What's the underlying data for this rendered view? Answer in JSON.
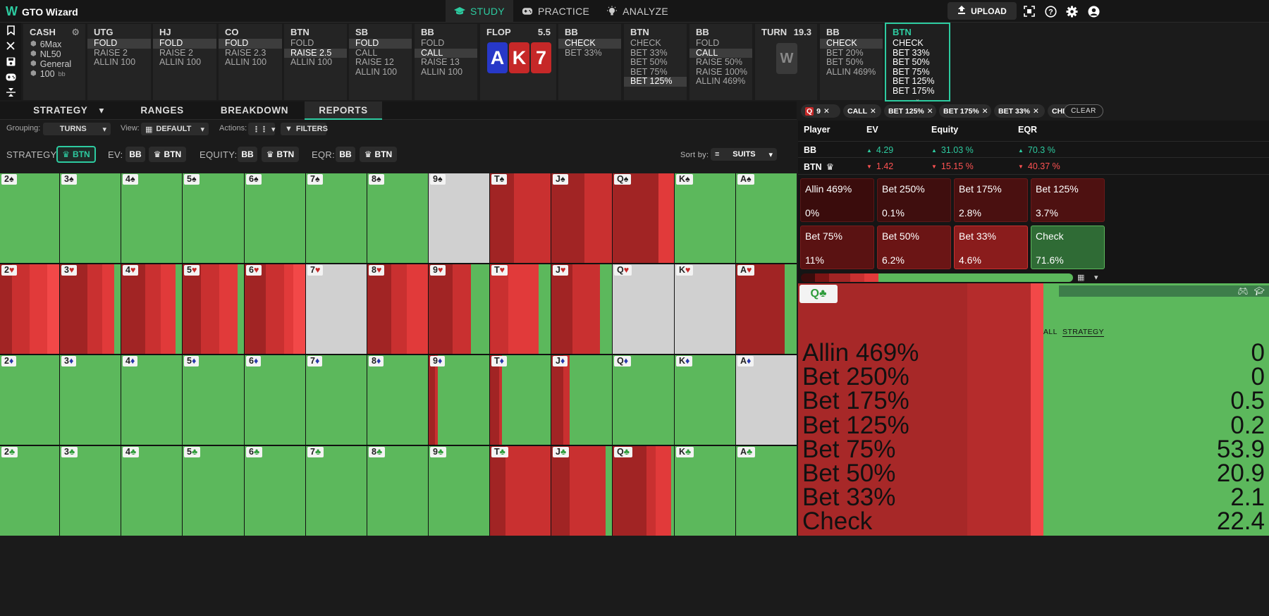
{
  "app": {
    "title": "GTO Wizard",
    "logo": "W",
    "brand_color": "#2dcba0"
  },
  "nav": {
    "tabs": [
      {
        "label": "STUDY",
        "icon": "graduation-cap-icon"
      },
      {
        "label": "PRACTICE",
        "icon": "gamepad-icon"
      },
      {
        "label": "ANALYZE",
        "icon": "lightbulb-icon"
      }
    ],
    "upload": "UPLOAD"
  },
  "tree": {
    "cash": {
      "title": "CASH",
      "rows": [
        "6Max",
        "NL50",
        "General",
        "100"
      ],
      "bb_unit": "bb"
    },
    "cols": [
      {
        "head": "UTG",
        "rows": [
          "FOLD",
          "RAISE 2",
          "ALLIN 100"
        ],
        "sel": 0
      },
      {
        "head": "HJ",
        "rows": [
          "FOLD",
          "RAISE 2",
          "ALLIN 100"
        ],
        "sel": 0
      },
      {
        "head": "CO",
        "rows": [
          "FOLD",
          "RAISE 2.3",
          "ALLIN 100"
        ],
        "sel": 0
      },
      {
        "head": "BTN",
        "rows": [
          "FOLD",
          "RAISE 2.5",
          "ALLIN 100"
        ],
        "sel": 1
      },
      {
        "head": "SB",
        "rows": [
          "FOLD",
          "CALL",
          "RAISE 12",
          "ALLIN 100"
        ],
        "sel": 0
      },
      {
        "head": "BB",
        "rows": [
          "FOLD",
          "CALL",
          "RAISE 13",
          "ALLIN 100"
        ],
        "sel": 1
      },
      {
        "head": "BB",
        "rows": [
          "CHECK",
          "BET 33%"
        ],
        "sel": 0
      },
      {
        "head": "BTN",
        "rows": [
          "CHECK",
          "BET 33%",
          "BET 50%",
          "BET 75%",
          "BET 125%"
        ],
        "sel": 4
      },
      {
        "head": "BB",
        "rows": [
          "FOLD",
          "CALL",
          "RAISE 50%",
          "RAISE 100%",
          "ALLIN 469%"
        ],
        "sel": 1
      },
      {
        "head": "BB",
        "rows": [
          "CHECK",
          "BET 20%",
          "BET 50%",
          "ALLIN 469%"
        ],
        "sel": 0
      },
      {
        "head": "BTN",
        "rows": [
          "CHECK",
          "BET 33%",
          "BET 50%",
          "BET 75%",
          "BET 125%",
          "BET 175%"
        ],
        "sel": -1
      }
    ],
    "flop": {
      "label": "FLOP",
      "pot": "5.5",
      "cards": [
        "A",
        "K",
        "7"
      ]
    },
    "turn": {
      "label": "TURN",
      "pot": "19.3",
      "card": "W"
    }
  },
  "tabs": [
    "STRATEGY",
    "RANGES",
    "BREAKDOWN",
    "REPORTS"
  ],
  "chips": [
    {
      "label": "Q",
      "extra": "9"
    },
    {
      "label": "CALL"
    },
    {
      "label": "BET 125%"
    },
    {
      "label": "BET 175%"
    },
    {
      "label": "BET 33%"
    },
    {
      "label": "CHE"
    }
  ],
  "clear": "CLEAR",
  "filters": {
    "grouping_label": "Grouping:",
    "grouping": "TURNS",
    "view_label": "View:",
    "view": "DEFAULT",
    "actions_label": "Actions:",
    "filters": "FILTERS"
  },
  "metrics": {
    "strategy_label": "STRATEGY:",
    "strategy_btn": "BTN",
    "ev_label": "EV:",
    "equity_label": "EQUITY:",
    "eqr_label": "EQR:",
    "bb": "BB",
    "btn": "BTN",
    "sort_label": "Sort by:",
    "sort": "SUITS"
  },
  "grid": {
    "ranks": [
      "2",
      "3",
      "4",
      "5",
      "6",
      "7",
      "8",
      "9",
      "T",
      "J",
      "Q",
      "K",
      "A"
    ],
    "suits": [
      {
        "sym": "♠",
        "cls": "suit-s"
      },
      {
        "sym": "♥",
        "cls": "suit-h"
      },
      {
        "sym": "♦",
        "cls": "suit-d"
      },
      {
        "sym": "♣",
        "cls": "suit-c"
      }
    ],
    "colors": {
      "allin": "#5e0f0f",
      "bet250": "#7a1414",
      "bet175": "#8b1c1c",
      "bet125": "#a12424",
      "bet75": "#c93030",
      "bet50": "#e13a3a",
      "bet33": "#f24848",
      "check": "#5cb85c",
      "blocked": "#d0d0d0"
    }
  },
  "stats": {
    "headers": [
      "Player",
      "EV",
      "Equity",
      "EQR"
    ],
    "rows": [
      {
        "player": "BB",
        "ev": "4.29",
        "equity": "31.03 %",
        "eqr": "70.3 %",
        "dir": "up"
      },
      {
        "player": "BTN",
        "ev": "1.42",
        "equity": "15.15 %",
        "eqr": "40.37 %",
        "dir": "down"
      }
    ]
  },
  "actions": [
    {
      "label": "Allin 469%",
      "value": "0%"
    },
    {
      "label": "Bet 250%",
      "value": "0.1%"
    },
    {
      "label": "Bet 175%",
      "value": "2.8%"
    },
    {
      "label": "Bet 125%",
      "value": "3.7%"
    },
    {
      "label": "Bet 75%",
      "value": "11%"
    },
    {
      "label": "Bet 50%",
      "value": "6.2%"
    },
    {
      "label": "Bet 33%",
      "value": "4.6%"
    },
    {
      "label": "Check",
      "value": "71.6%"
    }
  ],
  "card_detail": {
    "card": "Q",
    "suit": "♣",
    "tab_all": "ALL",
    "tab_strategy": "STRATEGY",
    "lines": [
      {
        "label": "Allin 469%",
        "value": "0"
      },
      {
        "label": "Bet 250%",
        "value": "0"
      },
      {
        "label": "Bet 175%",
        "value": "0.5"
      },
      {
        "label": "Bet 125%",
        "value": "0.2"
      },
      {
        "label": "Bet 75%",
        "value": "53.9"
      },
      {
        "label": "Bet 50%",
        "value": "20.9"
      },
      {
        "label": "Bet 33%",
        "value": "2.1"
      },
      {
        "label": "Check",
        "value": "22.4"
      }
    ]
  }
}
